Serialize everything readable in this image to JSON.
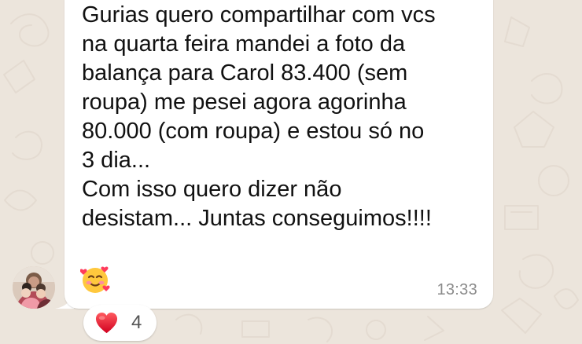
{
  "chat": {
    "message": {
      "text": "Gurias quero compartilhar com vcs\nna quarta feira mandei a foto da\nbalança para Carol 83.400 (sem\nroupa) me pesei agora agorinha\n80.000 (com roupa) e estou só no\n3 dia...\nCom isso quero dizer não\ndesistam... Juntas conseguimos!!!!",
      "emoji": "smiling-face-with-hearts",
      "time": "13:33"
    },
    "reaction": {
      "emoji": "red-heart",
      "count": "4"
    },
    "sender": {
      "avatar": "group-photo-avatar"
    }
  },
  "colors": {
    "background": "#ece5dc",
    "bubble": "#ffffff",
    "timestamp": "#8a8a8a",
    "heart": "#e0212b"
  }
}
